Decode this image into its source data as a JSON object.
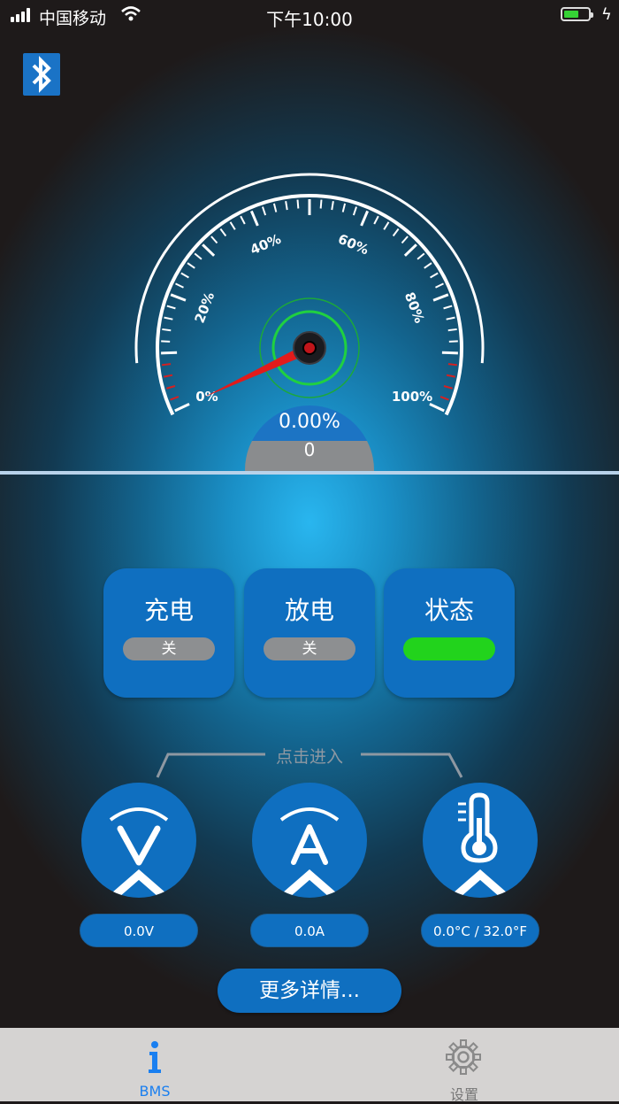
{
  "status_bar": {
    "carrier": "中国移动",
    "time": "下午10:00"
  },
  "gauge": {
    "tick_labels": [
      "0%",
      "20%",
      "40%",
      "60%",
      "80%",
      "100%"
    ],
    "percent_text": "0.00%",
    "raw_value": "0",
    "needle_value_percent": 0
  },
  "cards": [
    {
      "title": "充电",
      "pill": "关",
      "state": "off"
    },
    {
      "title": "放电",
      "pill": "关",
      "state": "off"
    },
    {
      "title": "状态",
      "pill": "",
      "state": "on"
    }
  ],
  "enter_label": "点击进入",
  "meters": [
    {
      "icon": "voltage-icon",
      "value": "0.0V"
    },
    {
      "icon": "current-icon",
      "value": "0.0A"
    },
    {
      "icon": "thermometer-icon",
      "value": "0.0°C / 32.0°F"
    }
  ],
  "more_button": "更多详情...",
  "tabs": [
    {
      "label": "BMS",
      "icon": "info-icon",
      "active": true
    },
    {
      "label": "设置",
      "icon": "gear-icon",
      "active": false
    }
  ],
  "colors": {
    "accent_blue": "#0f6fc0",
    "status_green": "#22d31c",
    "active_tab": "#1a7ff0",
    "inactive_tab": "#8a8a8a"
  }
}
